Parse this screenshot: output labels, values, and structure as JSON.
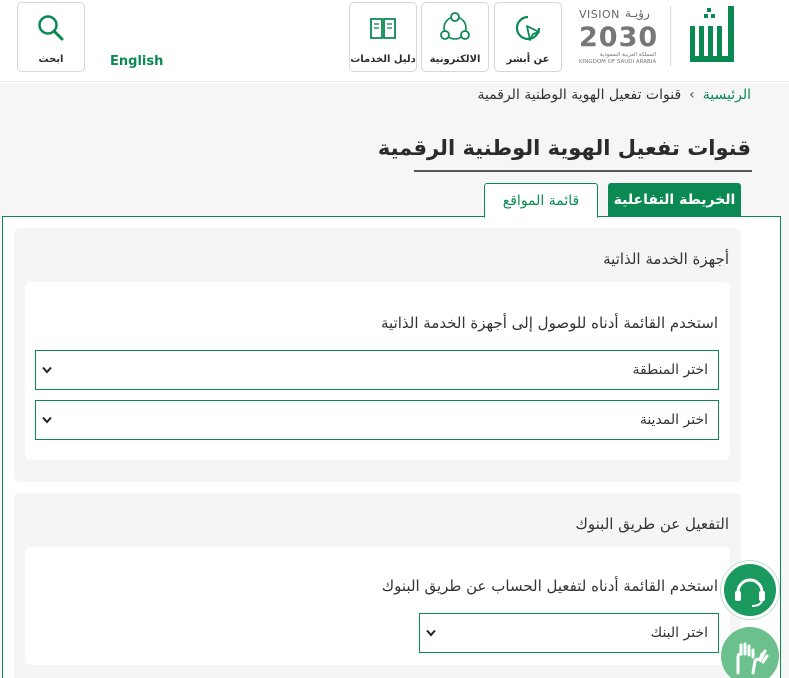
{
  "header": {
    "search_label": "ابحث",
    "language_link": "English",
    "buttons": [
      {
        "label": "دليل الخدمات",
        "icon": "book-icon"
      },
      {
        "label": "الالكترونية",
        "icon": "share-network-icon"
      },
      {
        "label": "عن أبشر",
        "icon": "pointer-circle-icon"
      }
    ],
    "vision": {
      "word": "VISION",
      "arabic": "رؤيـة",
      "year": "2030",
      "sub_ar": "المملكة العربية السعودية",
      "sub_en": "KINGDOM OF SAUDI ARABIA"
    }
  },
  "breadcrumb": {
    "home": "الرئيسية",
    "separator": "›",
    "current": "قنوات تفعيل الهوية الوطنية الرقمية"
  },
  "page_title": "قنوات تفعيل الهوية الوطنية الرقمية",
  "tabs": [
    {
      "label": "الخريطة التفاعلية",
      "active": true
    },
    {
      "label": "قائمة المواقع",
      "active": false
    }
  ],
  "sections": {
    "self_service": {
      "title": "أجهزة الخدمة الذاتية",
      "instruction": "استخدم القائمة أدناه للوصول إلى أجهزة الخدمة الذاتية",
      "region_select": "اختر المنطقة",
      "city_select": "اختر المدينة"
    },
    "banks": {
      "title": "التفعيل عن طريق البنوك",
      "instruction": "استخدم القائمة أدناه لتفعيل الحساب عن طريق البنوك",
      "bank_select": "اختر البنك"
    }
  },
  "colors": {
    "brand_green": "#0a8a52",
    "light_green": "#6cc08b"
  }
}
